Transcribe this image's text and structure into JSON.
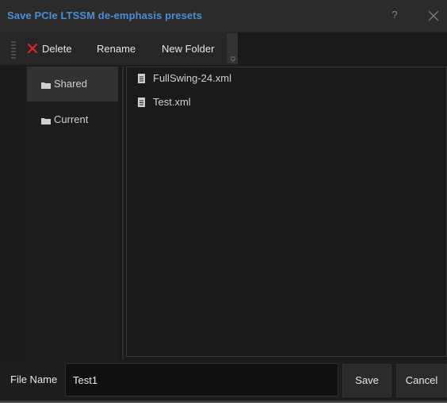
{
  "dialog": {
    "title": "Save PCIe LTSSM de-emphasis presets",
    "help_label": "?",
    "accent_color": "#4a8fd6"
  },
  "toolbar": {
    "delete_label": "Delete",
    "rename_label": "Rename",
    "new_folder_label": "New Folder",
    "delete_icon": "x-icon",
    "delete_icon_color": "#e0262a"
  },
  "folders": [
    {
      "label": "Shared",
      "icon": "folder-icon",
      "selected": true
    },
    {
      "label": "Current",
      "icon": "folder-icon",
      "selected": false
    }
  ],
  "files": [
    {
      "name": "FullSwing-24.xml",
      "icon": "file-icon"
    },
    {
      "name": "Test.xml",
      "icon": "file-icon"
    }
  ],
  "footer": {
    "file_name_label": "File Name",
    "file_name_value": "Test1",
    "save_label": "Save",
    "cancel_label": "Cancel"
  }
}
